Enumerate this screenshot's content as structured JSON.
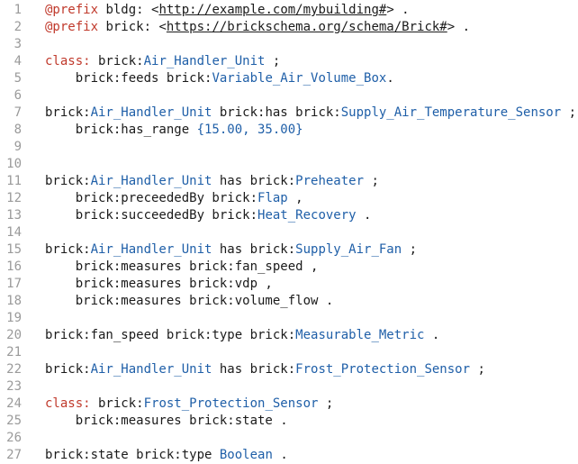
{
  "editor": {
    "lines": [
      {
        "n": "1",
        "tokens": [
          {
            "t": "@prefix",
            "c": "kw"
          },
          {
            "t": " bldg: <",
            "c": "pl"
          },
          {
            "t": "http://example.com/mybuilding#",
            "c": "url"
          },
          {
            "t": "> .",
            "c": "pl"
          }
        ]
      },
      {
        "n": "2",
        "tokens": [
          {
            "t": "@prefix",
            "c": "kw"
          },
          {
            "t": " brick: <",
            "c": "pl"
          },
          {
            "t": "https://brickschema.org/schema/Brick#",
            "c": "url"
          },
          {
            "t": "> .",
            "c": "pl"
          }
        ]
      },
      {
        "n": "3",
        "tokens": []
      },
      {
        "n": "4",
        "tokens": [
          {
            "t": "class:",
            "c": "kw"
          },
          {
            "t": " brick:",
            "c": "pl"
          },
          {
            "t": "Air_Handler_Unit",
            "c": "cls"
          },
          {
            "t": " ;",
            "c": "pl"
          }
        ]
      },
      {
        "n": "5",
        "tokens": [
          {
            "t": "    brick:feeds brick:",
            "c": "pl"
          },
          {
            "t": "Variable_Air_Volume_Box",
            "c": "cls"
          },
          {
            "t": ".",
            "c": "pl"
          }
        ]
      },
      {
        "n": "6",
        "tokens": []
      },
      {
        "n": "7",
        "tokens": [
          {
            "t": "brick:",
            "c": "pl"
          },
          {
            "t": "Air_Handler_Unit",
            "c": "cls"
          },
          {
            "t": " brick:has brick:",
            "c": "pl"
          },
          {
            "t": "Supply_Air_Temperature_Sensor",
            "c": "cls"
          },
          {
            "t": " ;",
            "c": "pl"
          }
        ]
      },
      {
        "n": "8",
        "tokens": [
          {
            "t": "    brick:has_range ",
            "c": "pl"
          },
          {
            "t": "{15.00, 35.00}",
            "c": "num"
          }
        ]
      },
      {
        "n": "9",
        "tokens": []
      },
      {
        "n": "10",
        "tokens": []
      },
      {
        "n": "11",
        "tokens": [
          {
            "t": "brick:",
            "c": "pl"
          },
          {
            "t": "Air_Handler_Unit",
            "c": "cls"
          },
          {
            "t": " has brick:",
            "c": "pl"
          },
          {
            "t": "Preheater",
            "c": "cls"
          },
          {
            "t": " ;",
            "c": "pl"
          }
        ]
      },
      {
        "n": "12",
        "tokens": [
          {
            "t": "    brick:preceededBy brick:",
            "c": "pl"
          },
          {
            "t": "Flap",
            "c": "cls"
          },
          {
            "t": " ,",
            "c": "pl"
          }
        ]
      },
      {
        "n": "13",
        "tokens": [
          {
            "t": "    brick:succeededBy brick:",
            "c": "pl"
          },
          {
            "t": "Heat_Recovery",
            "c": "cls"
          },
          {
            "t": " .",
            "c": "pl"
          }
        ]
      },
      {
        "n": "14",
        "tokens": []
      },
      {
        "n": "15",
        "tokens": [
          {
            "t": "brick:",
            "c": "pl"
          },
          {
            "t": "Air_Handler_Unit",
            "c": "cls"
          },
          {
            "t": " has brick:",
            "c": "pl"
          },
          {
            "t": "Supply_Air_Fan",
            "c": "cls"
          },
          {
            "t": " ;",
            "c": "pl"
          }
        ]
      },
      {
        "n": "16",
        "tokens": [
          {
            "t": "    brick:measures brick:fan_speed ,",
            "c": "pl"
          }
        ]
      },
      {
        "n": "17",
        "tokens": [
          {
            "t": "    brick:measures brick:vdp ,",
            "c": "pl"
          }
        ]
      },
      {
        "n": "18",
        "tokens": [
          {
            "t": "    brick:measures brick:volume_flow .",
            "c": "pl"
          }
        ]
      },
      {
        "n": "19",
        "tokens": []
      },
      {
        "n": "20",
        "tokens": [
          {
            "t": "brick:fan_speed brick:type brick:",
            "c": "pl"
          },
          {
            "t": "Measurable_Metric",
            "c": "cls"
          },
          {
            "t": " .",
            "c": "pl"
          }
        ]
      },
      {
        "n": "21",
        "tokens": []
      },
      {
        "n": "22",
        "tokens": [
          {
            "t": "brick:",
            "c": "pl"
          },
          {
            "t": "Air_Handler_Unit",
            "c": "cls"
          },
          {
            "t": " has brick:",
            "c": "pl"
          },
          {
            "t": "Frost_Protection_Sensor",
            "c": "cls"
          },
          {
            "t": " ;",
            "c": "pl"
          }
        ]
      },
      {
        "n": "23",
        "tokens": []
      },
      {
        "n": "24",
        "tokens": [
          {
            "t": "class:",
            "c": "kw"
          },
          {
            "t": " brick:",
            "c": "pl"
          },
          {
            "t": "Frost_Protection_Sensor",
            "c": "cls"
          },
          {
            "t": " ;",
            "c": "pl"
          }
        ]
      },
      {
        "n": "25",
        "tokens": [
          {
            "t": "    brick:measures brick:state .",
            "c": "pl"
          }
        ]
      },
      {
        "n": "26",
        "tokens": []
      },
      {
        "n": "27",
        "tokens": [
          {
            "t": "brick:state brick:type ",
            "c": "pl"
          },
          {
            "t": "Boolean",
            "c": "cls"
          },
          {
            "t": " .",
            "c": "pl"
          }
        ]
      }
    ]
  },
  "colors": {
    "keyword": "#c0392b",
    "class_name": "#1f5fa8",
    "plain": "#1a1a1a",
    "line_number": "#9a9a9a"
  }
}
